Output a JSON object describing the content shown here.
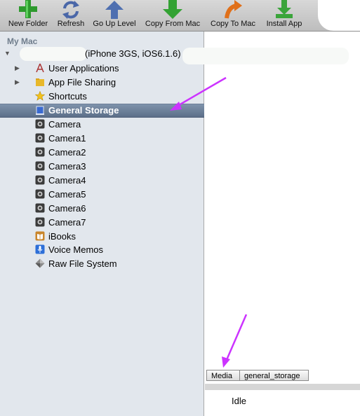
{
  "toolbar": {
    "buttons": [
      {
        "label": "New Folder",
        "icon": "plus-icon"
      },
      {
        "label": "Refresh",
        "icon": "refresh-icon"
      },
      {
        "label": "Go Up Level",
        "icon": "up-arrow-icon"
      },
      {
        "label": "Copy From Mac",
        "icon": "down-arrow-icon"
      },
      {
        "label": "Copy To Mac",
        "icon": "curved-arrow-icon"
      },
      {
        "label": "Install App",
        "icon": "install-icon"
      }
    ]
  },
  "sidebar": {
    "section_header": "My Mac",
    "device": {
      "label": "(iPhone 3GS, iOS6.1.6)"
    },
    "items": [
      {
        "label": "User Applications",
        "icon": "applications-icon",
        "expandable": true
      },
      {
        "label": "App File Sharing",
        "icon": "folder-icon",
        "expandable": true
      },
      {
        "label": "Shortcuts",
        "icon": "star-icon"
      },
      {
        "label": "General Storage",
        "icon": "drive-icon",
        "selected": true
      },
      {
        "label": "Camera",
        "icon": "camera-icon"
      },
      {
        "label": "Camera1",
        "icon": "camera-icon"
      },
      {
        "label": "Camera2",
        "icon": "camera-icon"
      },
      {
        "label": "Camera3",
        "icon": "camera-icon"
      },
      {
        "label": "Camera4",
        "icon": "camera-icon"
      },
      {
        "label": "Camera5",
        "icon": "camera-icon"
      },
      {
        "label": "Camera6",
        "icon": "camera-icon"
      },
      {
        "label": "Camera7",
        "icon": "camera-icon"
      },
      {
        "label": "iBooks",
        "icon": "book-icon"
      },
      {
        "label": "Voice Memos",
        "icon": "microphone-icon"
      },
      {
        "label": "Raw File System",
        "icon": "filesystem-icon"
      }
    ]
  },
  "pathbar": {
    "crumbs": [
      "Media",
      "general_storage"
    ]
  },
  "status": {
    "text": "Idle"
  },
  "colors": {
    "selection": "#6b7f9a",
    "sidebar_bg": "#e2e7ed",
    "annotation_arrow": "#cc33ff"
  }
}
